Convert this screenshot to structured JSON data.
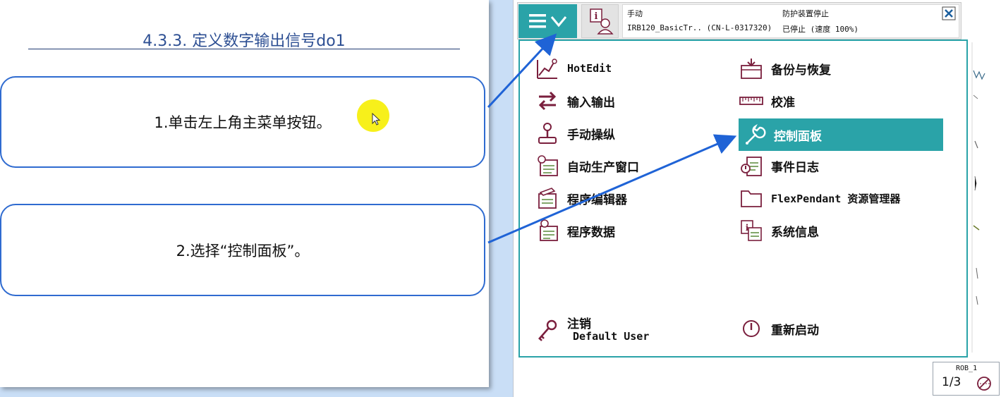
{
  "slide": {
    "title": "4.3.3. 定义数字输出信号do1",
    "step1": "1.单击左上角主菜单按钮。",
    "step2": "2.选择“控制面板”。"
  },
  "pendant": {
    "status": {
      "mode": "手动",
      "controller": "IRB120_BasicTr.. (CN-L-0317320)",
      "safety": "防护装置停止",
      "state": "已停止 (速度 100%)"
    },
    "menu_left": [
      {
        "label": "HotEdit",
        "icon": "hotedit-icon"
      },
      {
        "label": "输入输出",
        "icon": "io-arrows-icon"
      },
      {
        "label": "手动操纵",
        "icon": "joystick-icon"
      },
      {
        "label": "自动生产窗口",
        "icon": "auto-production-icon"
      },
      {
        "label": "程序编辑器",
        "icon": "program-editor-icon"
      },
      {
        "label": "程序数据",
        "icon": "program-data-icon"
      }
    ],
    "menu_right": [
      {
        "label": "备份与恢复",
        "icon": "backup-restore-icon"
      },
      {
        "label": "校准",
        "icon": "calibration-icon"
      },
      {
        "label": "控制面板",
        "icon": "wrench-icon",
        "selected": true
      },
      {
        "label": "事件日志",
        "icon": "event-log-icon"
      },
      {
        "label": "FlexPendant 资源管理器",
        "icon": "folder-icon"
      },
      {
        "label": "系统信息",
        "icon": "system-info-icon"
      }
    ],
    "logout": {
      "label": "注销",
      "user": "Default User"
    },
    "restart": {
      "label": "重新启动"
    },
    "task": {
      "robot": "ROB_1",
      "fraction": "1/3"
    },
    "accent_color": "#2aa3a8"
  }
}
